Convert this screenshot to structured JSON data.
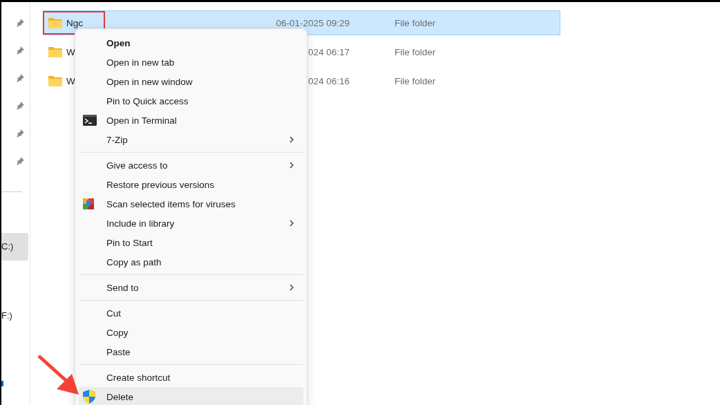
{
  "sidebar": {
    "drives": [
      {
        "label": "C:)",
        "selected": true
      },
      {
        "label": "F:)",
        "selected": false
      }
    ]
  },
  "files": [
    {
      "name": "Ngc",
      "date": "06-01-2025 09:29",
      "type": "File folder",
      "selected": true,
      "outlined": true
    },
    {
      "name": "W",
      "date": "024 06:17",
      "type": "File folder",
      "selected": false,
      "outlined": false
    },
    {
      "name": "W",
      "date": "024 06:16",
      "type": "File folder",
      "selected": false,
      "outlined": false
    }
  ],
  "context_menu": {
    "items": [
      {
        "kind": "item",
        "label": "Open",
        "bold": true,
        "submenu": false,
        "highlighted": false
      },
      {
        "kind": "item",
        "label": "Open in new tab",
        "bold": false,
        "submenu": false,
        "highlighted": false
      },
      {
        "kind": "item",
        "label": "Open in new window",
        "bold": false,
        "submenu": false,
        "highlighted": false
      },
      {
        "kind": "item",
        "label": "Pin to Quick access",
        "bold": false,
        "submenu": false,
        "highlighted": false
      },
      {
        "kind": "terminal",
        "label": "Open in Terminal",
        "bold": false,
        "submenu": false,
        "highlighted": false
      },
      {
        "kind": "item",
        "label": "7-Zip",
        "bold": false,
        "submenu": true,
        "highlighted": false
      },
      {
        "kind": "separator"
      },
      {
        "kind": "item",
        "label": "Give access to",
        "bold": false,
        "submenu": true,
        "highlighted": false
      },
      {
        "kind": "item",
        "label": "Restore previous versions",
        "bold": false,
        "submenu": false,
        "highlighted": false
      },
      {
        "kind": "antivirus",
        "label": "Scan selected items for viruses",
        "bold": false,
        "submenu": false,
        "highlighted": false
      },
      {
        "kind": "item",
        "label": "Include in library",
        "bold": false,
        "submenu": true,
        "highlighted": false
      },
      {
        "kind": "item",
        "label": "Pin to Start",
        "bold": false,
        "submenu": false,
        "highlighted": false
      },
      {
        "kind": "item",
        "label": "Copy as path",
        "bold": false,
        "submenu": false,
        "highlighted": false
      },
      {
        "kind": "separator"
      },
      {
        "kind": "item",
        "label": "Send to",
        "bold": false,
        "submenu": true,
        "highlighted": false
      },
      {
        "kind": "separator"
      },
      {
        "kind": "item",
        "label": "Cut",
        "bold": false,
        "submenu": false,
        "highlighted": false
      },
      {
        "kind": "item",
        "label": "Copy",
        "bold": false,
        "submenu": false,
        "highlighted": false
      },
      {
        "kind": "item",
        "label": "Paste",
        "bold": false,
        "submenu": false,
        "highlighted": false
      },
      {
        "kind": "separator"
      },
      {
        "kind": "item",
        "label": "Create shortcut",
        "bold": false,
        "submenu": false,
        "highlighted": false
      },
      {
        "kind": "shield",
        "label": "Delete",
        "bold": false,
        "submenu": false,
        "highlighted": true
      }
    ]
  }
}
